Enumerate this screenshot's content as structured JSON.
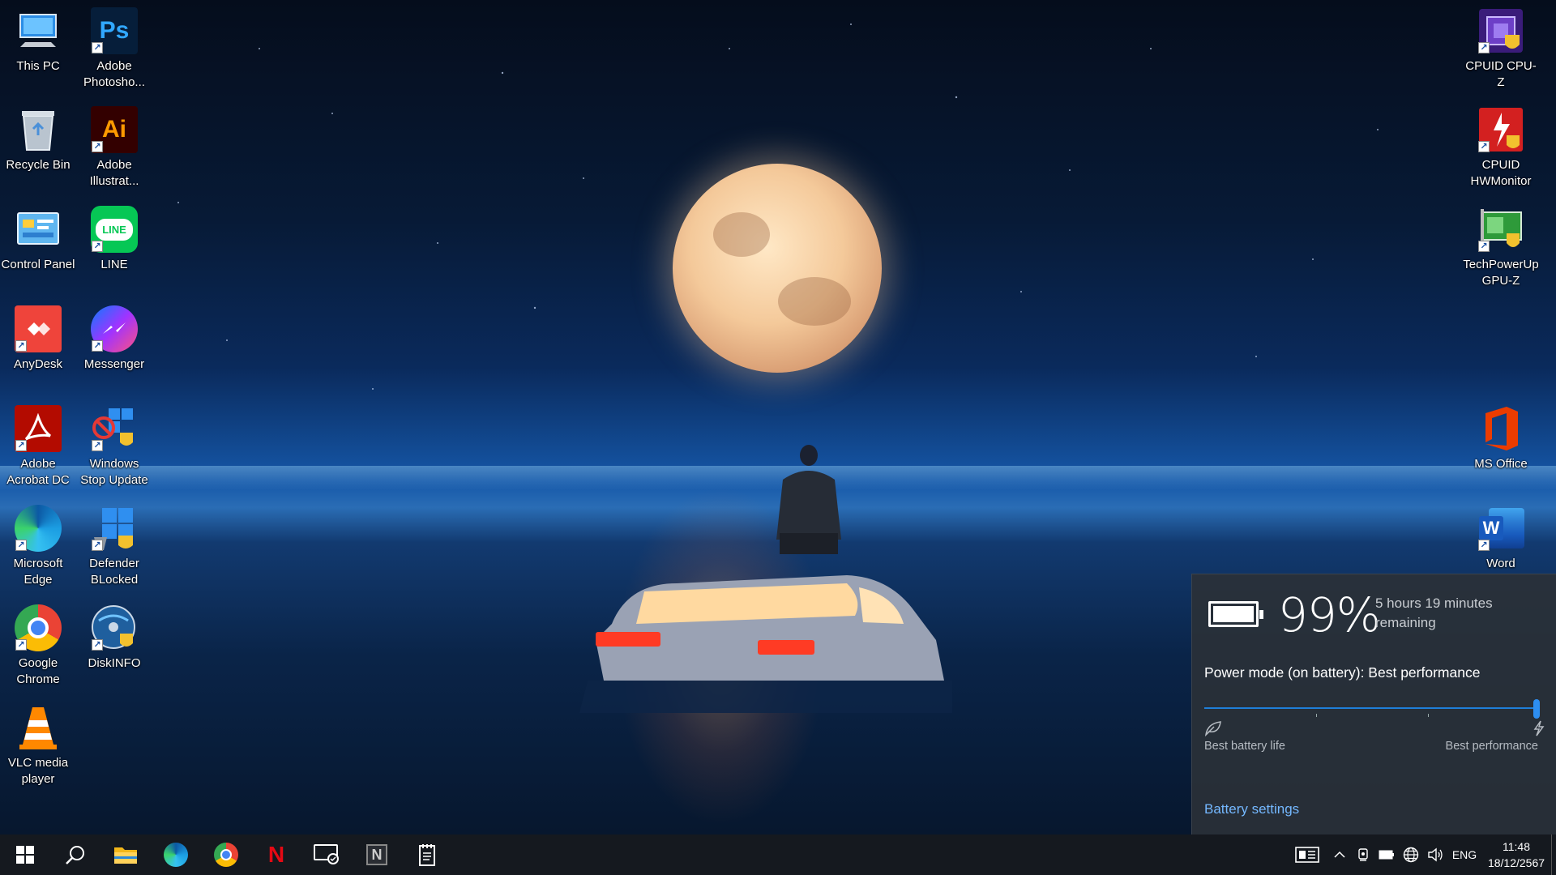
{
  "desktop": {
    "left_icons": [
      {
        "label": "This PC",
        "icon": "this-pc-icon"
      },
      {
        "label": "Adobe Photosho...",
        "icon": "photoshop-icon"
      },
      {
        "label": "Recycle Bin",
        "icon": "recycle-bin-icon"
      },
      {
        "label": "Adobe Illustrat...",
        "icon": "illustrator-icon"
      },
      {
        "label": "Control Panel",
        "icon": "control-panel-icon"
      },
      {
        "label": "LINE",
        "icon": "line-icon"
      },
      {
        "label": "AnyDesk",
        "icon": "anydesk-icon"
      },
      {
        "label": "Messenger",
        "icon": "messenger-icon"
      },
      {
        "label": "Adobe Acrobat DC",
        "icon": "acrobat-icon"
      },
      {
        "label": "Windows Stop Update",
        "icon": "windows-stop-update-icon"
      },
      {
        "label": "Microsoft Edge",
        "icon": "edge-icon"
      },
      {
        "label": "Defender BLocked",
        "icon": "defender-blocked-icon"
      },
      {
        "label": "Google Chrome",
        "icon": "chrome-icon"
      },
      {
        "label": "DiskINFO",
        "icon": "diskinfo-icon"
      },
      {
        "label": "VLC media player",
        "icon": "vlc-icon"
      }
    ],
    "right_icons": [
      {
        "label": "CPUID CPU-Z",
        "icon": "cpuz-icon"
      },
      {
        "label": "CPUID HWMonitor",
        "icon": "hwmonitor-icon"
      },
      {
        "label": "TechPowerUp GPU-Z",
        "icon": "gpuz-icon"
      },
      {
        "label": "MS Office",
        "icon": "office-icon"
      },
      {
        "label": "Word",
        "icon": "word-icon"
      }
    ],
    "icon_text": {
      "photoshop": "Ps",
      "illustrator": "Ai",
      "line": "LINE",
      "word": "W"
    }
  },
  "battery_flyout": {
    "percent": "99%",
    "percent_value": 99,
    "remaining": "5 hours 19 minutes remaining",
    "power_mode": "Power mode (on battery): Best performance",
    "slider_value": 1.0,
    "left_label": "Best battery life",
    "right_label": "Best performance",
    "settings_link": "Battery settings",
    "accent": "#2d8ef0",
    "link_color": "#74b8ff"
  },
  "taskbar": {
    "apps": [
      {
        "name": "start-button",
        "icon": "windows-logo-icon"
      },
      {
        "name": "search-button",
        "icon": "search-icon"
      },
      {
        "name": "file-explorer-button",
        "icon": "folder-icon"
      },
      {
        "name": "edge-taskbar-button",
        "icon": "edge-icon"
      },
      {
        "name": "chrome-taskbar-button",
        "icon": "chrome-icon"
      },
      {
        "name": "netflix-taskbar-button",
        "icon": "netflix-icon"
      },
      {
        "name": "display-taskbar-button",
        "icon": "monitor-icon"
      },
      {
        "name": "notion-taskbar-button",
        "icon": "notion-icon"
      },
      {
        "name": "notepad-taskbar-button",
        "icon": "notepad-icon"
      }
    ],
    "netflix_letter": "N",
    "notion_letter": "N",
    "language": "ENG",
    "time": "11:48",
    "date": "18/12/2567"
  }
}
